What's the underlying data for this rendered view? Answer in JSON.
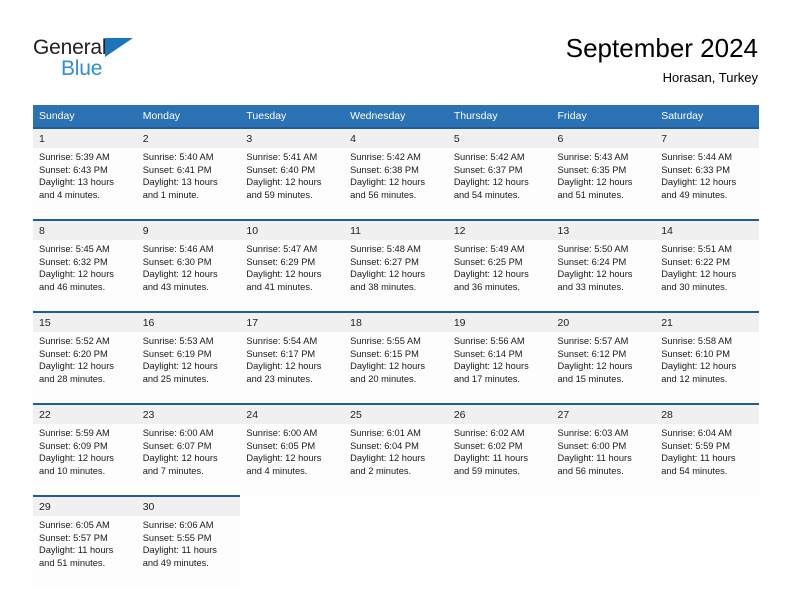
{
  "brand": {
    "name_part1": "General",
    "name_part2": "Blue",
    "triangle_icon": "triangle-icon",
    "accent_color": "#2e8fd6",
    "dark_color": "#231f20"
  },
  "header": {
    "title": "September 2024",
    "subtitle": "Horasan, Turkey"
  },
  "theme": {
    "header_bg": "#2b72b4",
    "separator": "#1f5c99",
    "daynum_bg": "#f0f0f0",
    "cell_bg": "#fdfdfd"
  },
  "weekdays": [
    "Sunday",
    "Monday",
    "Tuesday",
    "Wednesday",
    "Thursday",
    "Friday",
    "Saturday"
  ],
  "weeks": [
    [
      {
        "day": "1",
        "sunrise": "Sunrise: 5:39 AM",
        "sunset": "Sunset: 6:43 PM",
        "daylight1": "Daylight: 13 hours",
        "daylight2": "and 4 minutes."
      },
      {
        "day": "2",
        "sunrise": "Sunrise: 5:40 AM",
        "sunset": "Sunset: 6:41 PM",
        "daylight1": "Daylight: 13 hours",
        "daylight2": "and 1 minute."
      },
      {
        "day": "3",
        "sunrise": "Sunrise: 5:41 AM",
        "sunset": "Sunset: 6:40 PM",
        "daylight1": "Daylight: 12 hours",
        "daylight2": "and 59 minutes."
      },
      {
        "day": "4",
        "sunrise": "Sunrise: 5:42 AM",
        "sunset": "Sunset: 6:38 PM",
        "daylight1": "Daylight: 12 hours",
        "daylight2": "and 56 minutes."
      },
      {
        "day": "5",
        "sunrise": "Sunrise: 5:42 AM",
        "sunset": "Sunset: 6:37 PM",
        "daylight1": "Daylight: 12 hours",
        "daylight2": "and 54 minutes."
      },
      {
        "day": "6",
        "sunrise": "Sunrise: 5:43 AM",
        "sunset": "Sunset: 6:35 PM",
        "daylight1": "Daylight: 12 hours",
        "daylight2": "and 51 minutes."
      },
      {
        "day": "7",
        "sunrise": "Sunrise: 5:44 AM",
        "sunset": "Sunset: 6:33 PM",
        "daylight1": "Daylight: 12 hours",
        "daylight2": "and 49 minutes."
      }
    ],
    [
      {
        "day": "8",
        "sunrise": "Sunrise: 5:45 AM",
        "sunset": "Sunset: 6:32 PM",
        "daylight1": "Daylight: 12 hours",
        "daylight2": "and 46 minutes."
      },
      {
        "day": "9",
        "sunrise": "Sunrise: 5:46 AM",
        "sunset": "Sunset: 6:30 PM",
        "daylight1": "Daylight: 12 hours",
        "daylight2": "and 43 minutes."
      },
      {
        "day": "10",
        "sunrise": "Sunrise: 5:47 AM",
        "sunset": "Sunset: 6:29 PM",
        "daylight1": "Daylight: 12 hours",
        "daylight2": "and 41 minutes."
      },
      {
        "day": "11",
        "sunrise": "Sunrise: 5:48 AM",
        "sunset": "Sunset: 6:27 PM",
        "daylight1": "Daylight: 12 hours",
        "daylight2": "and 38 minutes."
      },
      {
        "day": "12",
        "sunrise": "Sunrise: 5:49 AM",
        "sunset": "Sunset: 6:25 PM",
        "daylight1": "Daylight: 12 hours",
        "daylight2": "and 36 minutes."
      },
      {
        "day": "13",
        "sunrise": "Sunrise: 5:50 AM",
        "sunset": "Sunset: 6:24 PM",
        "daylight1": "Daylight: 12 hours",
        "daylight2": "and 33 minutes."
      },
      {
        "day": "14",
        "sunrise": "Sunrise: 5:51 AM",
        "sunset": "Sunset: 6:22 PM",
        "daylight1": "Daylight: 12 hours",
        "daylight2": "and 30 minutes."
      }
    ],
    [
      {
        "day": "15",
        "sunrise": "Sunrise: 5:52 AM",
        "sunset": "Sunset: 6:20 PM",
        "daylight1": "Daylight: 12 hours",
        "daylight2": "and 28 minutes."
      },
      {
        "day": "16",
        "sunrise": "Sunrise: 5:53 AM",
        "sunset": "Sunset: 6:19 PM",
        "daylight1": "Daylight: 12 hours",
        "daylight2": "and 25 minutes."
      },
      {
        "day": "17",
        "sunrise": "Sunrise: 5:54 AM",
        "sunset": "Sunset: 6:17 PM",
        "daylight1": "Daylight: 12 hours",
        "daylight2": "and 23 minutes."
      },
      {
        "day": "18",
        "sunrise": "Sunrise: 5:55 AM",
        "sunset": "Sunset: 6:15 PM",
        "daylight1": "Daylight: 12 hours",
        "daylight2": "and 20 minutes."
      },
      {
        "day": "19",
        "sunrise": "Sunrise: 5:56 AM",
        "sunset": "Sunset: 6:14 PM",
        "daylight1": "Daylight: 12 hours",
        "daylight2": "and 17 minutes."
      },
      {
        "day": "20",
        "sunrise": "Sunrise: 5:57 AM",
        "sunset": "Sunset: 6:12 PM",
        "daylight1": "Daylight: 12 hours",
        "daylight2": "and 15 minutes."
      },
      {
        "day": "21",
        "sunrise": "Sunrise: 5:58 AM",
        "sunset": "Sunset: 6:10 PM",
        "daylight1": "Daylight: 12 hours",
        "daylight2": "and 12 minutes."
      }
    ],
    [
      {
        "day": "22",
        "sunrise": "Sunrise: 5:59 AM",
        "sunset": "Sunset: 6:09 PM",
        "daylight1": "Daylight: 12 hours",
        "daylight2": "and 10 minutes."
      },
      {
        "day": "23",
        "sunrise": "Sunrise: 6:00 AM",
        "sunset": "Sunset: 6:07 PM",
        "daylight1": "Daylight: 12 hours",
        "daylight2": "and 7 minutes."
      },
      {
        "day": "24",
        "sunrise": "Sunrise: 6:00 AM",
        "sunset": "Sunset: 6:05 PM",
        "daylight1": "Daylight: 12 hours",
        "daylight2": "and 4 minutes."
      },
      {
        "day": "25",
        "sunrise": "Sunrise: 6:01 AM",
        "sunset": "Sunset: 6:04 PM",
        "daylight1": "Daylight: 12 hours",
        "daylight2": "and 2 minutes."
      },
      {
        "day": "26",
        "sunrise": "Sunrise: 6:02 AM",
        "sunset": "Sunset: 6:02 PM",
        "daylight1": "Daylight: 11 hours",
        "daylight2": "and 59 minutes."
      },
      {
        "day": "27",
        "sunrise": "Sunrise: 6:03 AM",
        "sunset": "Sunset: 6:00 PM",
        "daylight1": "Daylight: 11 hours",
        "daylight2": "and 56 minutes."
      },
      {
        "day": "28",
        "sunrise": "Sunrise: 6:04 AM",
        "sunset": "Sunset: 5:59 PM",
        "daylight1": "Daylight: 11 hours",
        "daylight2": "and 54 minutes."
      }
    ],
    [
      {
        "day": "29",
        "sunrise": "Sunrise: 6:05 AM",
        "sunset": "Sunset: 5:57 PM",
        "daylight1": "Daylight: 11 hours",
        "daylight2": "and 51 minutes."
      },
      {
        "day": "30",
        "sunrise": "Sunrise: 6:06 AM",
        "sunset": "Sunset: 5:55 PM",
        "daylight1": "Daylight: 11 hours",
        "daylight2": "and 49 minutes."
      },
      {
        "day": "",
        "sunrise": "",
        "sunset": "",
        "daylight1": "",
        "daylight2": ""
      },
      {
        "day": "",
        "sunrise": "",
        "sunset": "",
        "daylight1": "",
        "daylight2": ""
      },
      {
        "day": "",
        "sunrise": "",
        "sunset": "",
        "daylight1": "",
        "daylight2": ""
      },
      {
        "day": "",
        "sunrise": "",
        "sunset": "",
        "daylight1": "",
        "daylight2": ""
      },
      {
        "day": "",
        "sunrise": "",
        "sunset": "",
        "daylight1": "",
        "daylight2": ""
      }
    ]
  ]
}
